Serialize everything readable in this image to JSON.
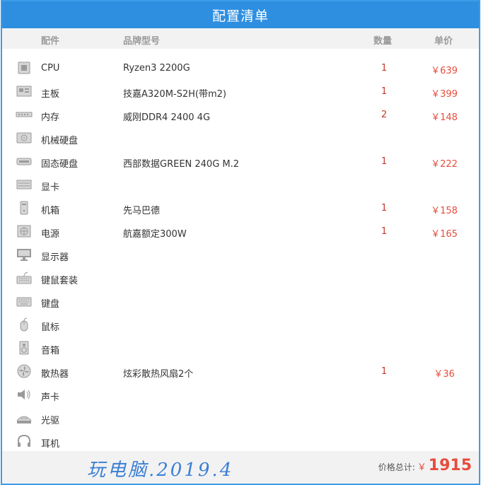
{
  "title": "配置清单",
  "columns": {
    "part": "配件",
    "model": "品牌型号",
    "qty": "数量",
    "price": "单价"
  },
  "rows": [
    {
      "icon": "cpu-icon",
      "part": "CPU",
      "model": "Ryzen3 2200G",
      "qty": "1",
      "price": "￥639"
    },
    {
      "icon": "motherboard-icon",
      "part": "主板",
      "model": "技嘉A320M-S2H(带m2)",
      "qty": "1",
      "price": "￥399"
    },
    {
      "icon": "memory-icon",
      "part": "内存",
      "model": "威刚DDR4 2400 4G",
      "qty": "2",
      "price": "￥148"
    },
    {
      "icon": "hdd-icon",
      "part": "机械硬盘",
      "model": "",
      "qty": "",
      "price": ""
    },
    {
      "icon": "ssd-icon",
      "part": "固态硬盘",
      "model": "西部数据GREEN 240G M.2",
      "qty": "1",
      "price": "￥222"
    },
    {
      "icon": "gpu-icon",
      "part": "显卡",
      "model": "",
      "qty": "",
      "price": ""
    },
    {
      "icon": "case-icon",
      "part": "机箱",
      "model": "先马巴德",
      "qty": "1",
      "price": "￥158"
    },
    {
      "icon": "psu-icon",
      "part": "电源",
      "model": "航嘉额定300W",
      "qty": "1",
      "price": "￥165"
    },
    {
      "icon": "monitor-icon",
      "part": "显示器",
      "model": "",
      "qty": "",
      "price": ""
    },
    {
      "icon": "keyboard-mouse-icon",
      "part": "键鼠套装",
      "model": "",
      "qty": "",
      "price": ""
    },
    {
      "icon": "keyboard-icon",
      "part": "键盘",
      "model": "",
      "qty": "",
      "price": ""
    },
    {
      "icon": "mouse-icon",
      "part": "鼠标",
      "model": "",
      "qty": "",
      "price": ""
    },
    {
      "icon": "speaker-icon",
      "part": "音箱",
      "model": "",
      "qty": "",
      "price": ""
    },
    {
      "icon": "fan-icon",
      "part": "散热器",
      "model": "炫彩散热风扇2个",
      "qty": "1",
      "price": "￥36"
    },
    {
      "icon": "sound-card-icon",
      "part": "声卡",
      "model": "",
      "qty": "",
      "price": ""
    },
    {
      "icon": "optical-drive-icon",
      "part": "光驱",
      "model": "",
      "qty": "",
      "price": ""
    },
    {
      "icon": "headphones-icon",
      "part": "耳机",
      "model": "",
      "qty": "",
      "price": ""
    }
  ],
  "footer": {
    "signature": "玩电脑.2019.4",
    "total_label": "价格总计:",
    "total_currency": "￥",
    "total_value": "1915"
  },
  "colors": {
    "title_bar": "#2e8fe0",
    "border": "#3d9be9",
    "price_red": "#e74c3c",
    "header_gray": "#f2f2f2"
  }
}
